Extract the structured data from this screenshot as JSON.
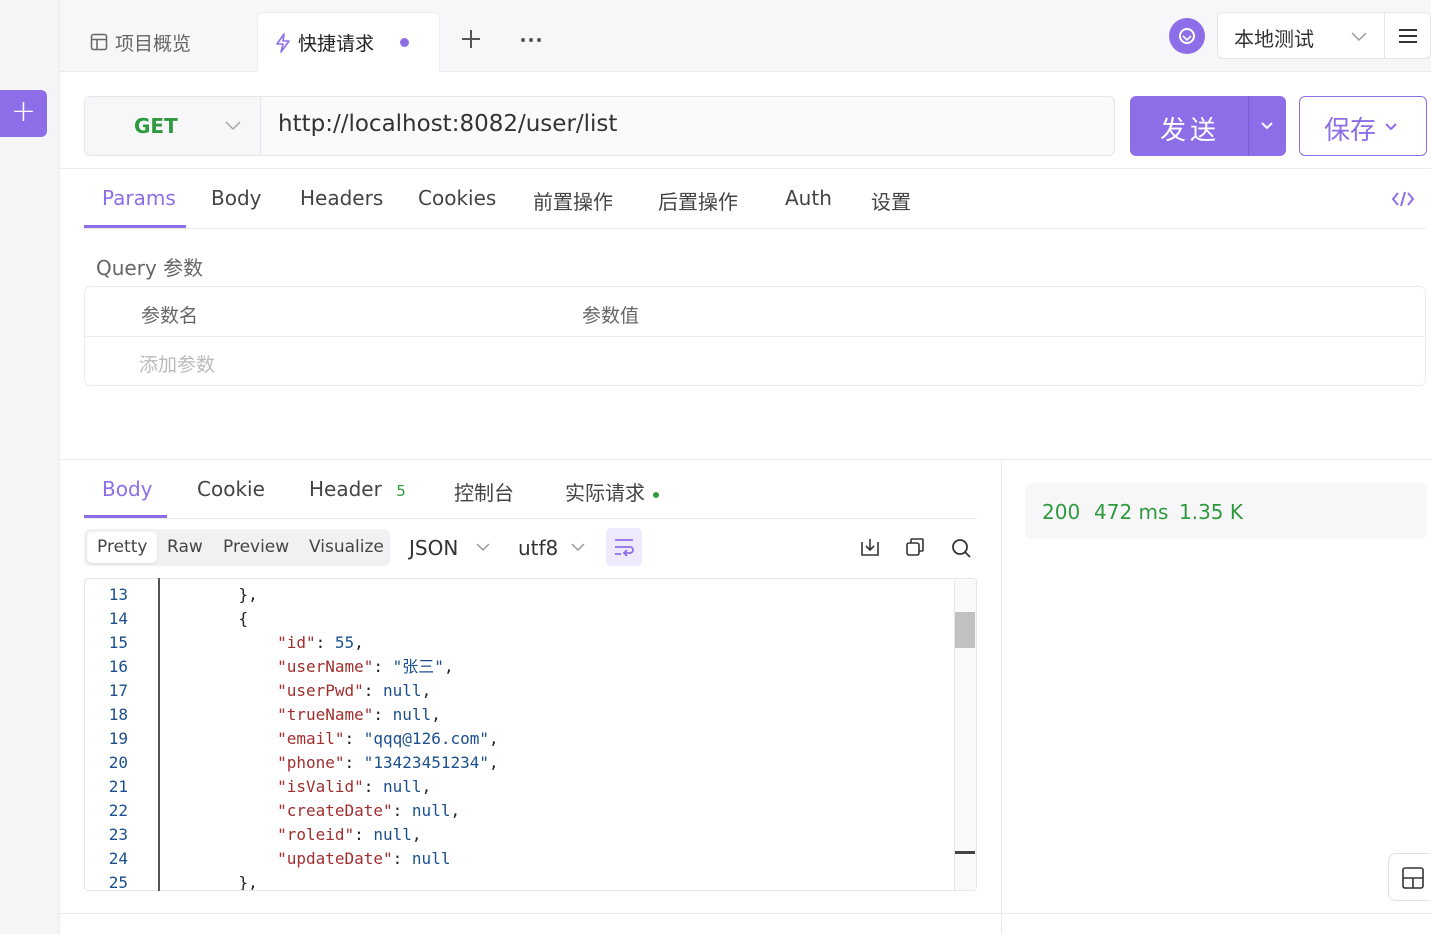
{
  "tabs": {
    "overview_label": "项目概览",
    "quick_label": "快捷请求"
  },
  "environment": {
    "selected": "本地测试"
  },
  "request": {
    "method": "GET",
    "url": "http://localhost:8082/user/list",
    "send_label": "发送",
    "save_label": "保存"
  },
  "param_tabs": [
    {
      "label": "Params"
    },
    {
      "label": "Body"
    },
    {
      "label": "Headers"
    },
    {
      "label": "Cookies"
    },
    {
      "label": "前置操作"
    },
    {
      "label": "后置操作"
    },
    {
      "label": "Auth"
    },
    {
      "label": "设置"
    }
  ],
  "query": {
    "title": "Query 参数",
    "col_name": "参数名",
    "col_value": "参数值",
    "add_placeholder": "添加参数"
  },
  "response_tabs": [
    {
      "label": "Body"
    },
    {
      "label": "Cookie"
    },
    {
      "label": "Header",
      "badge": "5"
    },
    {
      "label": "控制台"
    },
    {
      "label": "实际请求"
    }
  ],
  "view_modes": [
    "Pretty",
    "Raw",
    "Preview",
    "Visualize"
  ],
  "format": {
    "type": "JSON",
    "encoding": "utf8"
  },
  "code_lines": [
    {
      "n": "13",
      "t": "    },"
    },
    {
      "n": "14",
      "t": "    {"
    },
    {
      "n": "15",
      "t": "        \"id\": 55,"
    },
    {
      "n": "16",
      "t": "        \"userName\": \"张三\","
    },
    {
      "n": "17",
      "t": "        \"userPwd\": null,"
    },
    {
      "n": "18",
      "t": "        \"trueName\": null,"
    },
    {
      "n": "19",
      "t": "        \"email\": \"qqq@126.com\","
    },
    {
      "n": "20",
      "t": "        \"phone\": \"13423451234\","
    },
    {
      "n": "21",
      "t": "        \"isValid\": null,"
    },
    {
      "n": "22",
      "t": "        \"createDate\": null,"
    },
    {
      "n": "23",
      "t": "        \"roleid\": null,"
    },
    {
      "n": "24",
      "t": "        \"updateDate\": null"
    },
    {
      "n": "25",
      "t": "    },"
    }
  ],
  "stats": {
    "status": "200",
    "time": "472 ms",
    "size": "1.35 K"
  },
  "colors": {
    "accent": "#8e6ee8",
    "success": "#2e9a3d"
  }
}
